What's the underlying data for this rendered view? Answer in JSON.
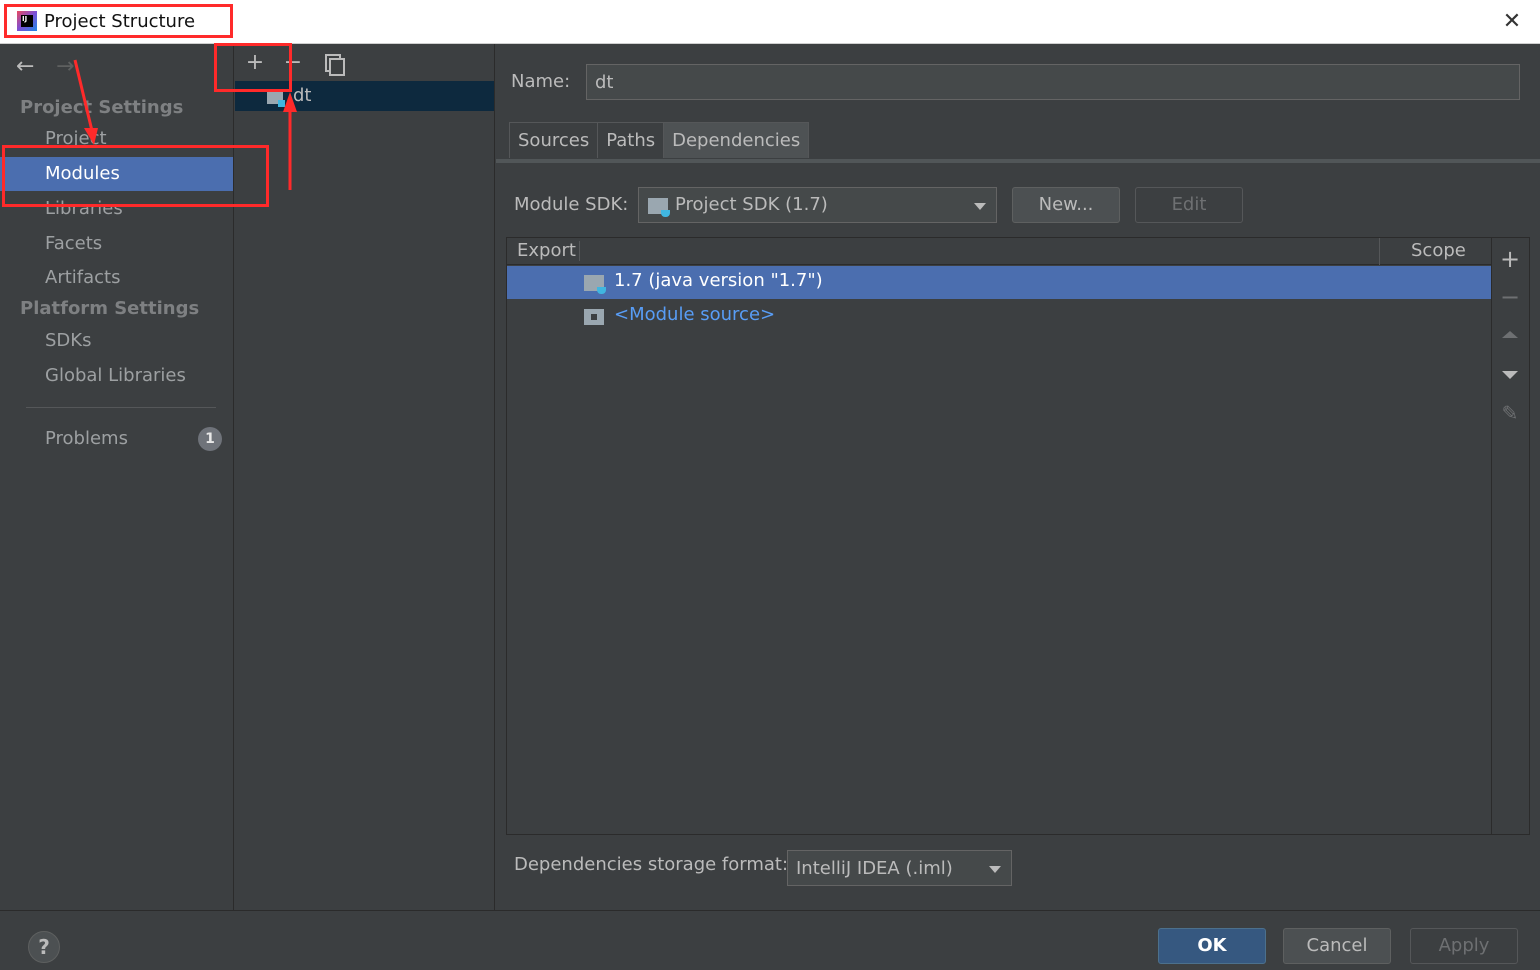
{
  "window": {
    "title": "Project Structure",
    "app_icon_text": "IJ",
    "close_icon": "close-icon"
  },
  "sidebar": {
    "back_icon": "←",
    "forward_icon": "→",
    "project_settings_header": "Project Settings",
    "platform_settings_header": "Platform Settings",
    "items": [
      {
        "label": "Project"
      },
      {
        "label": "Modules",
        "selected": true
      },
      {
        "label": "Libraries"
      },
      {
        "label": "Facets"
      },
      {
        "label": "Artifacts"
      },
      {
        "label": "SDKs"
      },
      {
        "label": "Global Libraries"
      },
      {
        "label": "Problems"
      }
    ],
    "problems_count": "1"
  },
  "modules": {
    "add_icon": "+",
    "remove_icon": "−",
    "list": [
      {
        "name": "dt"
      }
    ]
  },
  "main": {
    "name_label": "Name:",
    "name_value": "dt",
    "tabs": [
      {
        "label": "Sources"
      },
      {
        "label": "Paths"
      },
      {
        "label": "Dependencies",
        "active": true
      }
    ],
    "module_sdk_label": "Module SDK:",
    "module_sdk_value": "Project SDK (1.7)",
    "new_button": "New...",
    "edit_button": "Edit",
    "table": {
      "col_export": "Export",
      "col_scope": "Scope",
      "rows": [
        {
          "text": "1.7 (java version \"1.7\")",
          "selected": true
        },
        {
          "text": "<Module source>"
        }
      ]
    },
    "side_toolbar": {
      "add": "+",
      "remove": "−",
      "edit": "✎"
    },
    "storage_label": "Dependencies storage format:",
    "storage_value": "IntelliJ IDEA (.iml)"
  },
  "footer": {
    "help": "?",
    "ok": "OK",
    "cancel": "Cancel",
    "apply": "Apply"
  },
  "annotation_color": "#ff2a2a"
}
